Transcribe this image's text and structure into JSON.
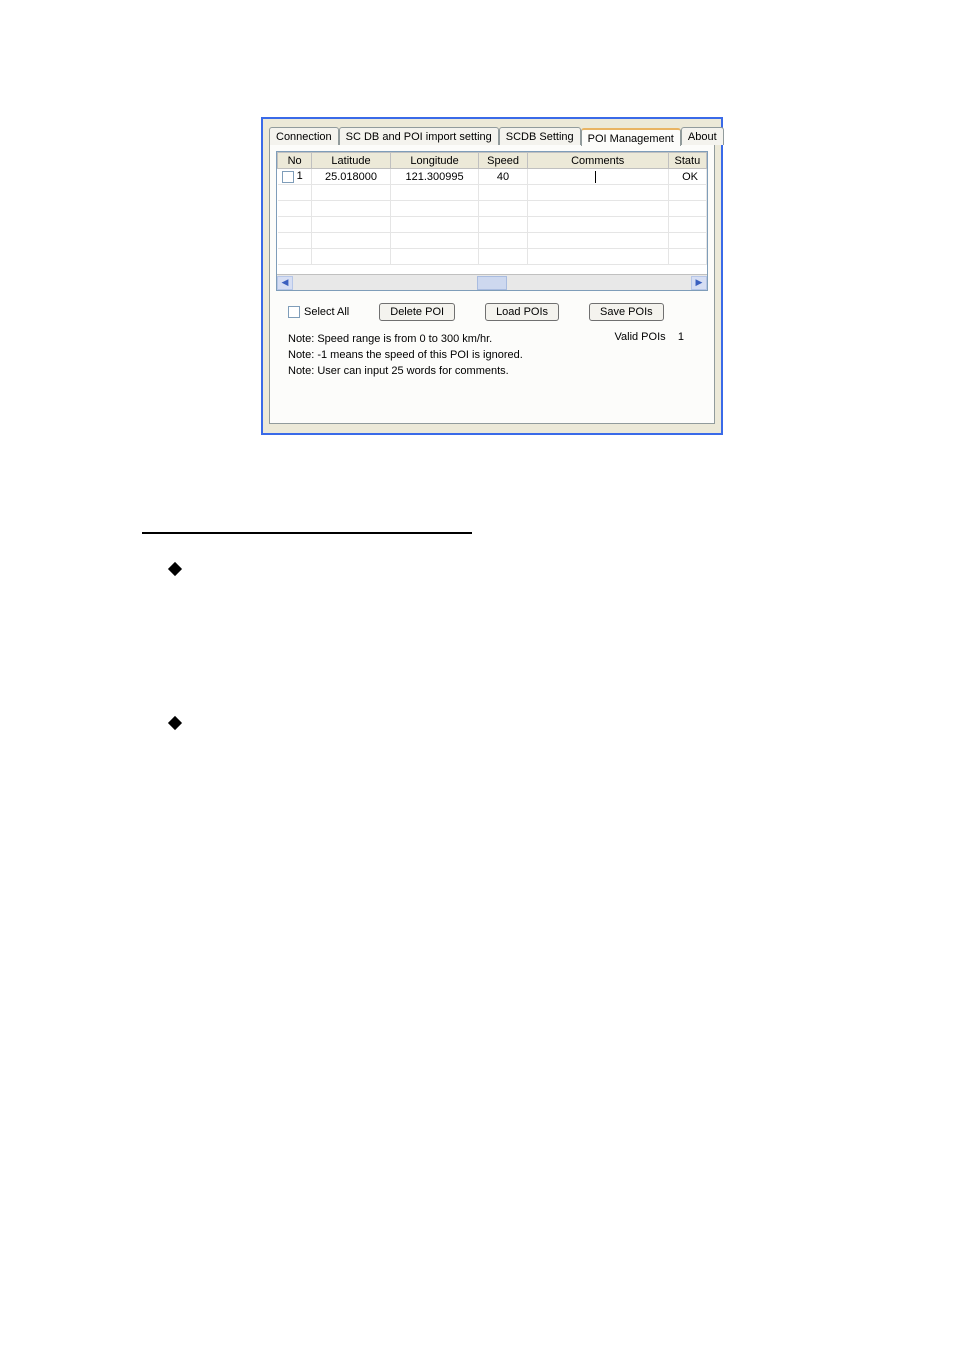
{
  "tabs": {
    "connection": "Connection",
    "scdb_poi_import": "SC DB and POI import setting",
    "scdb_setting": "SCDB Setting",
    "poi_management": "POI Management",
    "about": "About"
  },
  "columns": {
    "no": "No",
    "latitude": "Latitude",
    "longitude": "Longitude",
    "speed": "Speed",
    "comments": "Comments",
    "status": "Statu"
  },
  "rows": [
    {
      "no": "1",
      "latitude": "25.018000",
      "longitude": "121.300995",
      "speed": "40",
      "comments": "",
      "status": "OK"
    }
  ],
  "select_all_label": "Select All",
  "buttons": {
    "delete_poi": "Delete POI",
    "load_pois": "Load POIs",
    "save_pois": "Save POIs"
  },
  "valid_pois_label": "Valid POIs",
  "valid_pois_count": "1",
  "notes": {
    "note1": "Note: Speed range is from 0 to 300 km/hr.",
    "note2": "Note: -1 means the speed of this POI is ignored.",
    "note3": "Note:  User can input 25 words for comments."
  }
}
